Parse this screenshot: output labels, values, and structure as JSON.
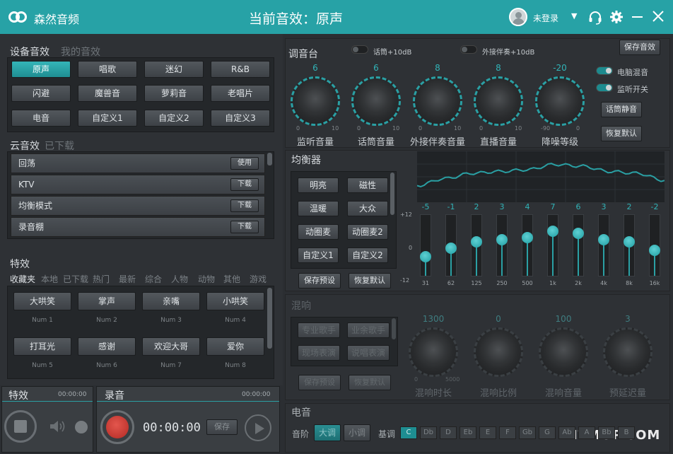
{
  "window": {
    "app_title": "森然音频",
    "current_effect": "当前音效：原声",
    "login_label": "未登录",
    "dropdown_glyph": "▼"
  },
  "device_effects": {
    "tab_active": "设备音效",
    "tab_inactive": "我的音效",
    "buttons": [
      "原声",
      "唱歌",
      "迷幻",
      "R&B",
      "闪避",
      "魔兽音",
      "萝莉音",
      "老唱片",
      "电音",
      "自定义1",
      "自定义2",
      "自定义3"
    ],
    "selected": "原声"
  },
  "cloud_effects": {
    "tab_active": "云音效",
    "tab_inactive": "已下载",
    "items": [
      {
        "name": "回荡",
        "action": "使用"
      },
      {
        "name": "KTV",
        "action": "下载"
      },
      {
        "name": "均衡模式",
        "action": "下载"
      },
      {
        "name": "录音棚",
        "action": "下载"
      }
    ]
  },
  "special_effects": {
    "title": "特效",
    "tabs": [
      "收藏夹",
      "本地",
      "已下载",
      "热门",
      "最新",
      "综合",
      "人物",
      "动物",
      "其他",
      "游戏"
    ],
    "active_tab": "收藏夹",
    "items": [
      {
        "label": "大哄笑",
        "num": "Num 1"
      },
      {
        "label": "掌声",
        "num": "Num 2"
      },
      {
        "label": "亲嘴",
        "num": "Num 3"
      },
      {
        "label": "小哄笑",
        "num": "Num 4"
      },
      {
        "label": "打耳光",
        "num": "Num 5"
      },
      {
        "label": "感谢",
        "num": "Num 6"
      },
      {
        "label": "欢迎大哥",
        "num": "Num 7"
      },
      {
        "label": "爱你",
        "num": "Num 8"
      }
    ]
  },
  "fx_player": {
    "title": "特效",
    "time": "00:00:00"
  },
  "recorder": {
    "title": "录音",
    "time_small": "00:00:00",
    "time": "00:00:00",
    "save_label": "保存"
  },
  "mixer": {
    "title": "调音台",
    "toggle_mic": "话筒+10dB",
    "toggle_ext": "外接伴奏+10dB",
    "save_effect": "保存音效",
    "knobs": [
      {
        "label": "监听音量",
        "value": "6",
        "min": "0",
        "max": "10"
      },
      {
        "label": "话筒音量",
        "value": "6",
        "min": "0",
        "max": "10"
      },
      {
        "label": "外接伴奏音量",
        "value": "8",
        "min": "0",
        "max": "10"
      },
      {
        "label": "直播音量",
        "value": "8",
        "min": "0",
        "max": "10"
      },
      {
        "label": "降噪等级",
        "value": "-20",
        "min": "-90",
        "max": "0"
      }
    ],
    "pc_mix": "电脑混音",
    "monitor_switch": "监听开关",
    "mic_mute": "话筒静音",
    "restore_default": "恢复默认"
  },
  "equalizer": {
    "title": "均衡器",
    "presets": [
      "明亮",
      "磁性",
      "温暖",
      "大众",
      "动圈麦",
      "动圈麦2",
      "自定义1",
      "自定义2"
    ],
    "save_preset": "保存预设",
    "restore_default": "恢复默认",
    "scale": [
      "+12",
      "0",
      "-12"
    ],
    "bands": [
      {
        "freq": "31",
        "value": "-5"
      },
      {
        "freq": "62",
        "value": "-1"
      },
      {
        "freq": "125",
        "value": "2"
      },
      {
        "freq": "250",
        "value": "3"
      },
      {
        "freq": "500",
        "value": "4"
      },
      {
        "freq": "1k",
        "value": "7"
      },
      {
        "freq": "2k",
        "value": "6"
      },
      {
        "freq": "4k",
        "value": "3"
      },
      {
        "freq": "8k",
        "value": "2"
      },
      {
        "freq": "16k",
        "value": "-2"
      }
    ]
  },
  "reverb": {
    "title": "混响",
    "presets": [
      "专业歌手",
      "业余歌手",
      "现场表演",
      "说唱表演"
    ],
    "save_preset": "保存预设",
    "restore_default": "恢复默认",
    "knobs": [
      {
        "label": "混响时长",
        "value": "1300",
        "min": "0",
        "max": "5000"
      },
      {
        "label": "混响比例",
        "value": "0",
        "min": "",
        "max": ""
      },
      {
        "label": "混响音量",
        "value": "100",
        "min": "",
        "max": ""
      },
      {
        "label": "预延迟量",
        "value": "3",
        "min": "",
        "max": ""
      }
    ]
  },
  "electro": {
    "title": "电音",
    "scale_label": "音阶",
    "major": "大调",
    "minor": "小调",
    "key_label": "基调",
    "keys": [
      "C",
      "Db",
      "D",
      "Eb",
      "E",
      "F",
      "Gb",
      "G",
      "Ab",
      "A",
      "Bb",
      "B"
    ],
    "selected_key": "C"
  },
  "watermark": "ITMOP.COM"
}
